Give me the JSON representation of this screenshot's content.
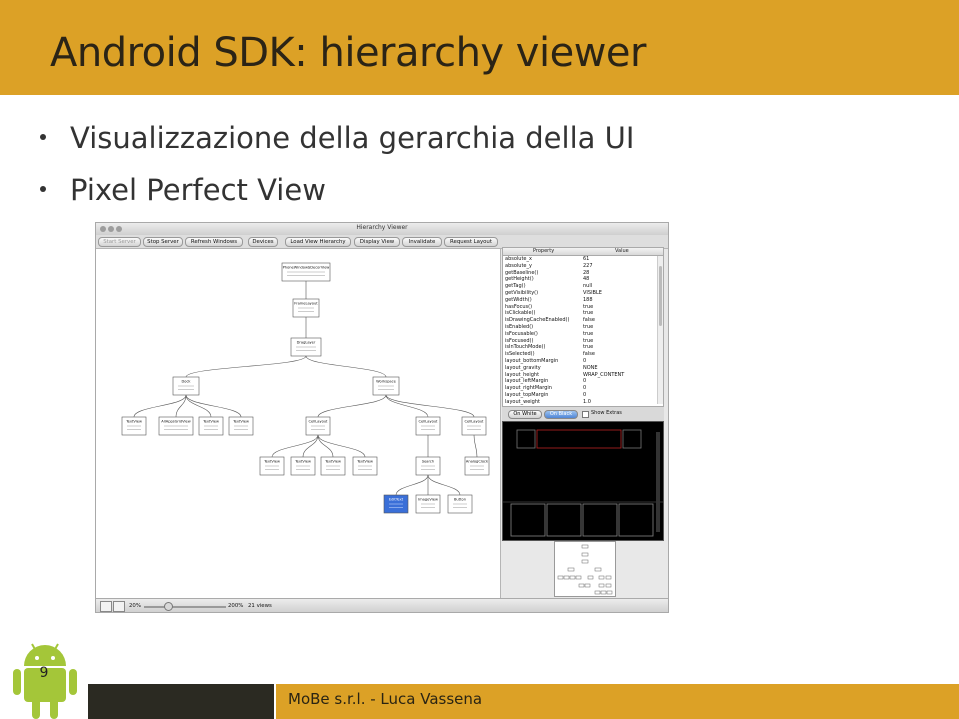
{
  "slide": {
    "title": "Android SDK: hierarchy viewer",
    "bullets": [
      "Visualizzazione della gerarchia della UI",
      "Pixel Perfect View"
    ],
    "page_number": "9",
    "footer": "MoBe s.r.l. - Luca Vassena",
    "colors": {
      "header": "#dca126",
      "footer_dark": "#2b2a22",
      "android_green": "#a4c639"
    }
  },
  "app": {
    "window_title": "Hierarchy Viewer",
    "toolbar": [
      "Start Server",
      "Stop Server",
      "Refresh Windows",
      "Devices",
      "Load View Hierarchy",
      "Display View",
      "Invalidate",
      "Request Layout"
    ],
    "properties": {
      "columns": [
        "Property",
        "Value"
      ],
      "rows": [
        [
          "absolute_x",
          "61"
        ],
        [
          "absolute_y",
          "227"
        ],
        [
          "getBaseline()",
          "28"
        ],
        [
          "getHeight()",
          "48"
        ],
        [
          "getTag()",
          "null"
        ],
        [
          "getVisibility()",
          "VISIBLE"
        ],
        [
          "getWidth()",
          "188"
        ],
        [
          "hasFocus()",
          "true"
        ],
        [
          "isClickable()",
          "true"
        ],
        [
          "isDrawingCacheEnabled()",
          "false"
        ],
        [
          "isEnabled()",
          "true"
        ],
        [
          "isFocusable()",
          "true"
        ],
        [
          "isFocused()",
          "true"
        ],
        [
          "isInTouchMode()",
          "true"
        ],
        [
          "isSelected()",
          "false"
        ],
        [
          "layout_bottomMargin",
          "0"
        ],
        [
          "layout_gravity",
          "NONE"
        ],
        [
          "layout_height",
          "WRAP_CONTENT"
        ],
        [
          "layout_leftMargin",
          "0"
        ],
        [
          "layout_rightMargin",
          "0"
        ],
        [
          "layout_topMargin",
          "0"
        ],
        [
          "layout_weight",
          "1.0"
        ]
      ]
    },
    "pixel_perfect": {
      "on_white": "On White",
      "on_black": "On Black",
      "show_extras": "Show Extras"
    },
    "status": {
      "zoom_min": "20%",
      "zoom_max": "200%",
      "views": "21 views"
    },
    "tree_nodes": [
      {
        "id": "n0",
        "label": "PhoneWindow$DecorView"
      },
      {
        "id": "n1",
        "label": "FrameLayout"
      },
      {
        "id": "n2",
        "label": "DragLayer"
      },
      {
        "id": "n3",
        "label": "Dock"
      },
      {
        "id": "n4",
        "label": "Workspace"
      },
      {
        "id": "n5",
        "label": "TextView"
      },
      {
        "id": "n6",
        "label": "AllAppsGridView"
      },
      {
        "id": "n7",
        "label": "TextView"
      },
      {
        "id": "n8",
        "label": "TextView"
      },
      {
        "id": "n9",
        "label": "CellLayout"
      },
      {
        "id": "n10",
        "label": "CellLayout"
      },
      {
        "id": "n11",
        "label": "CellLayout"
      },
      {
        "id": "n12",
        "label": "TextView"
      },
      {
        "id": "n13",
        "label": "TextView"
      },
      {
        "id": "n14",
        "label": "TextView"
      },
      {
        "id": "n15",
        "label": "TextView"
      },
      {
        "id": "n16",
        "label": "Search"
      },
      {
        "id": "n17",
        "label": "AnalogClock"
      },
      {
        "id": "n18",
        "label": "EditText"
      },
      {
        "id": "n19",
        "label": "ImageView"
      },
      {
        "id": "n20",
        "label": "Button"
      }
    ]
  }
}
